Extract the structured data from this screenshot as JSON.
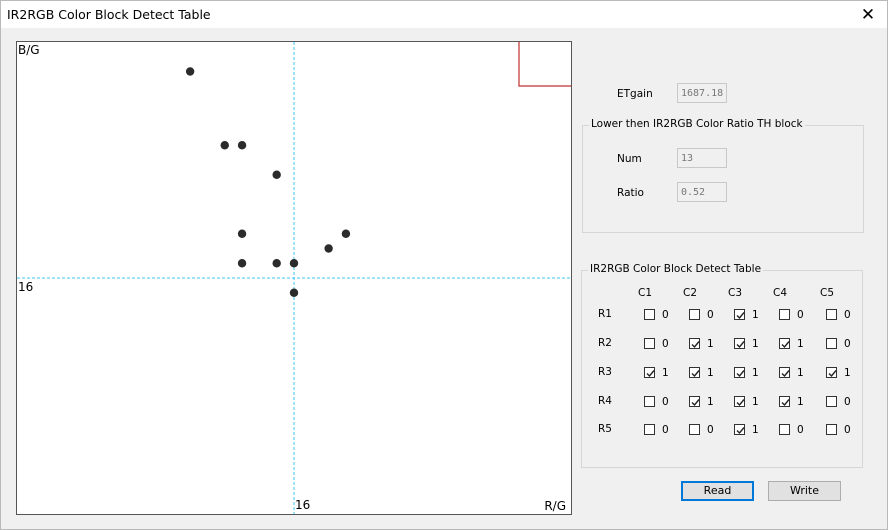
{
  "window": {
    "title": "IR2RGB Color Block Detect Table",
    "close_glyph": "✕"
  },
  "plot": {
    "y_axis_label": "B/G",
    "x_axis_label": "R/G",
    "h_line_label": "16",
    "v_line_label": "16",
    "point_color": "#2b2b2b",
    "guide_color": "#3cc8f0",
    "th_block_color": "#c03030"
  },
  "chart_data": {
    "type": "scatter",
    "x": [
      10,
      12,
      13,
      13,
      13,
      15,
      15,
      16,
      16,
      18,
      19
    ],
    "y": [
      30,
      25,
      25,
      19,
      17,
      23,
      17,
      17,
      15,
      18,
      19
    ]
  },
  "etgain": {
    "label": "ETgain",
    "value": "1687.18"
  },
  "lower_group": {
    "title": "Lower then IR2RGB Color Ratio TH block",
    "num_label": "Num",
    "num_value": "13",
    "ratio_label": "Ratio",
    "ratio_value": "0.52"
  },
  "table_group": {
    "title": "IR2RGB Color Block Detect Table",
    "columns": [
      "C1",
      "C2",
      "C3",
      "C4",
      "C5"
    ],
    "rows": [
      {
        "label": "R1",
        "cells": [
          {
            "checked": false,
            "value": "0"
          },
          {
            "checked": false,
            "value": "0"
          },
          {
            "checked": true,
            "value": "1"
          },
          {
            "checked": false,
            "value": "0"
          },
          {
            "checked": false,
            "value": "0"
          }
        ]
      },
      {
        "label": "R2",
        "cells": [
          {
            "checked": false,
            "value": "0"
          },
          {
            "checked": true,
            "value": "1"
          },
          {
            "checked": true,
            "value": "1"
          },
          {
            "checked": true,
            "value": "1"
          },
          {
            "checked": false,
            "value": "0"
          }
        ]
      },
      {
        "label": "R3",
        "cells": [
          {
            "checked": true,
            "value": "1"
          },
          {
            "checked": true,
            "value": "1"
          },
          {
            "checked": true,
            "value": "1"
          },
          {
            "checked": true,
            "value": "1"
          },
          {
            "checked": true,
            "value": "1"
          }
        ]
      },
      {
        "label": "R4",
        "cells": [
          {
            "checked": false,
            "value": "0"
          },
          {
            "checked": true,
            "value": "1"
          },
          {
            "checked": true,
            "value": "1"
          },
          {
            "checked": true,
            "value": "1"
          },
          {
            "checked": false,
            "value": "0"
          }
        ]
      },
      {
        "label": "R5",
        "cells": [
          {
            "checked": false,
            "value": "0"
          },
          {
            "checked": false,
            "value": "0"
          },
          {
            "checked": true,
            "value": "1"
          },
          {
            "checked": false,
            "value": "0"
          },
          {
            "checked": false,
            "value": "0"
          }
        ]
      }
    ]
  },
  "buttons": {
    "read_label": "Read",
    "write_label": "Write"
  }
}
